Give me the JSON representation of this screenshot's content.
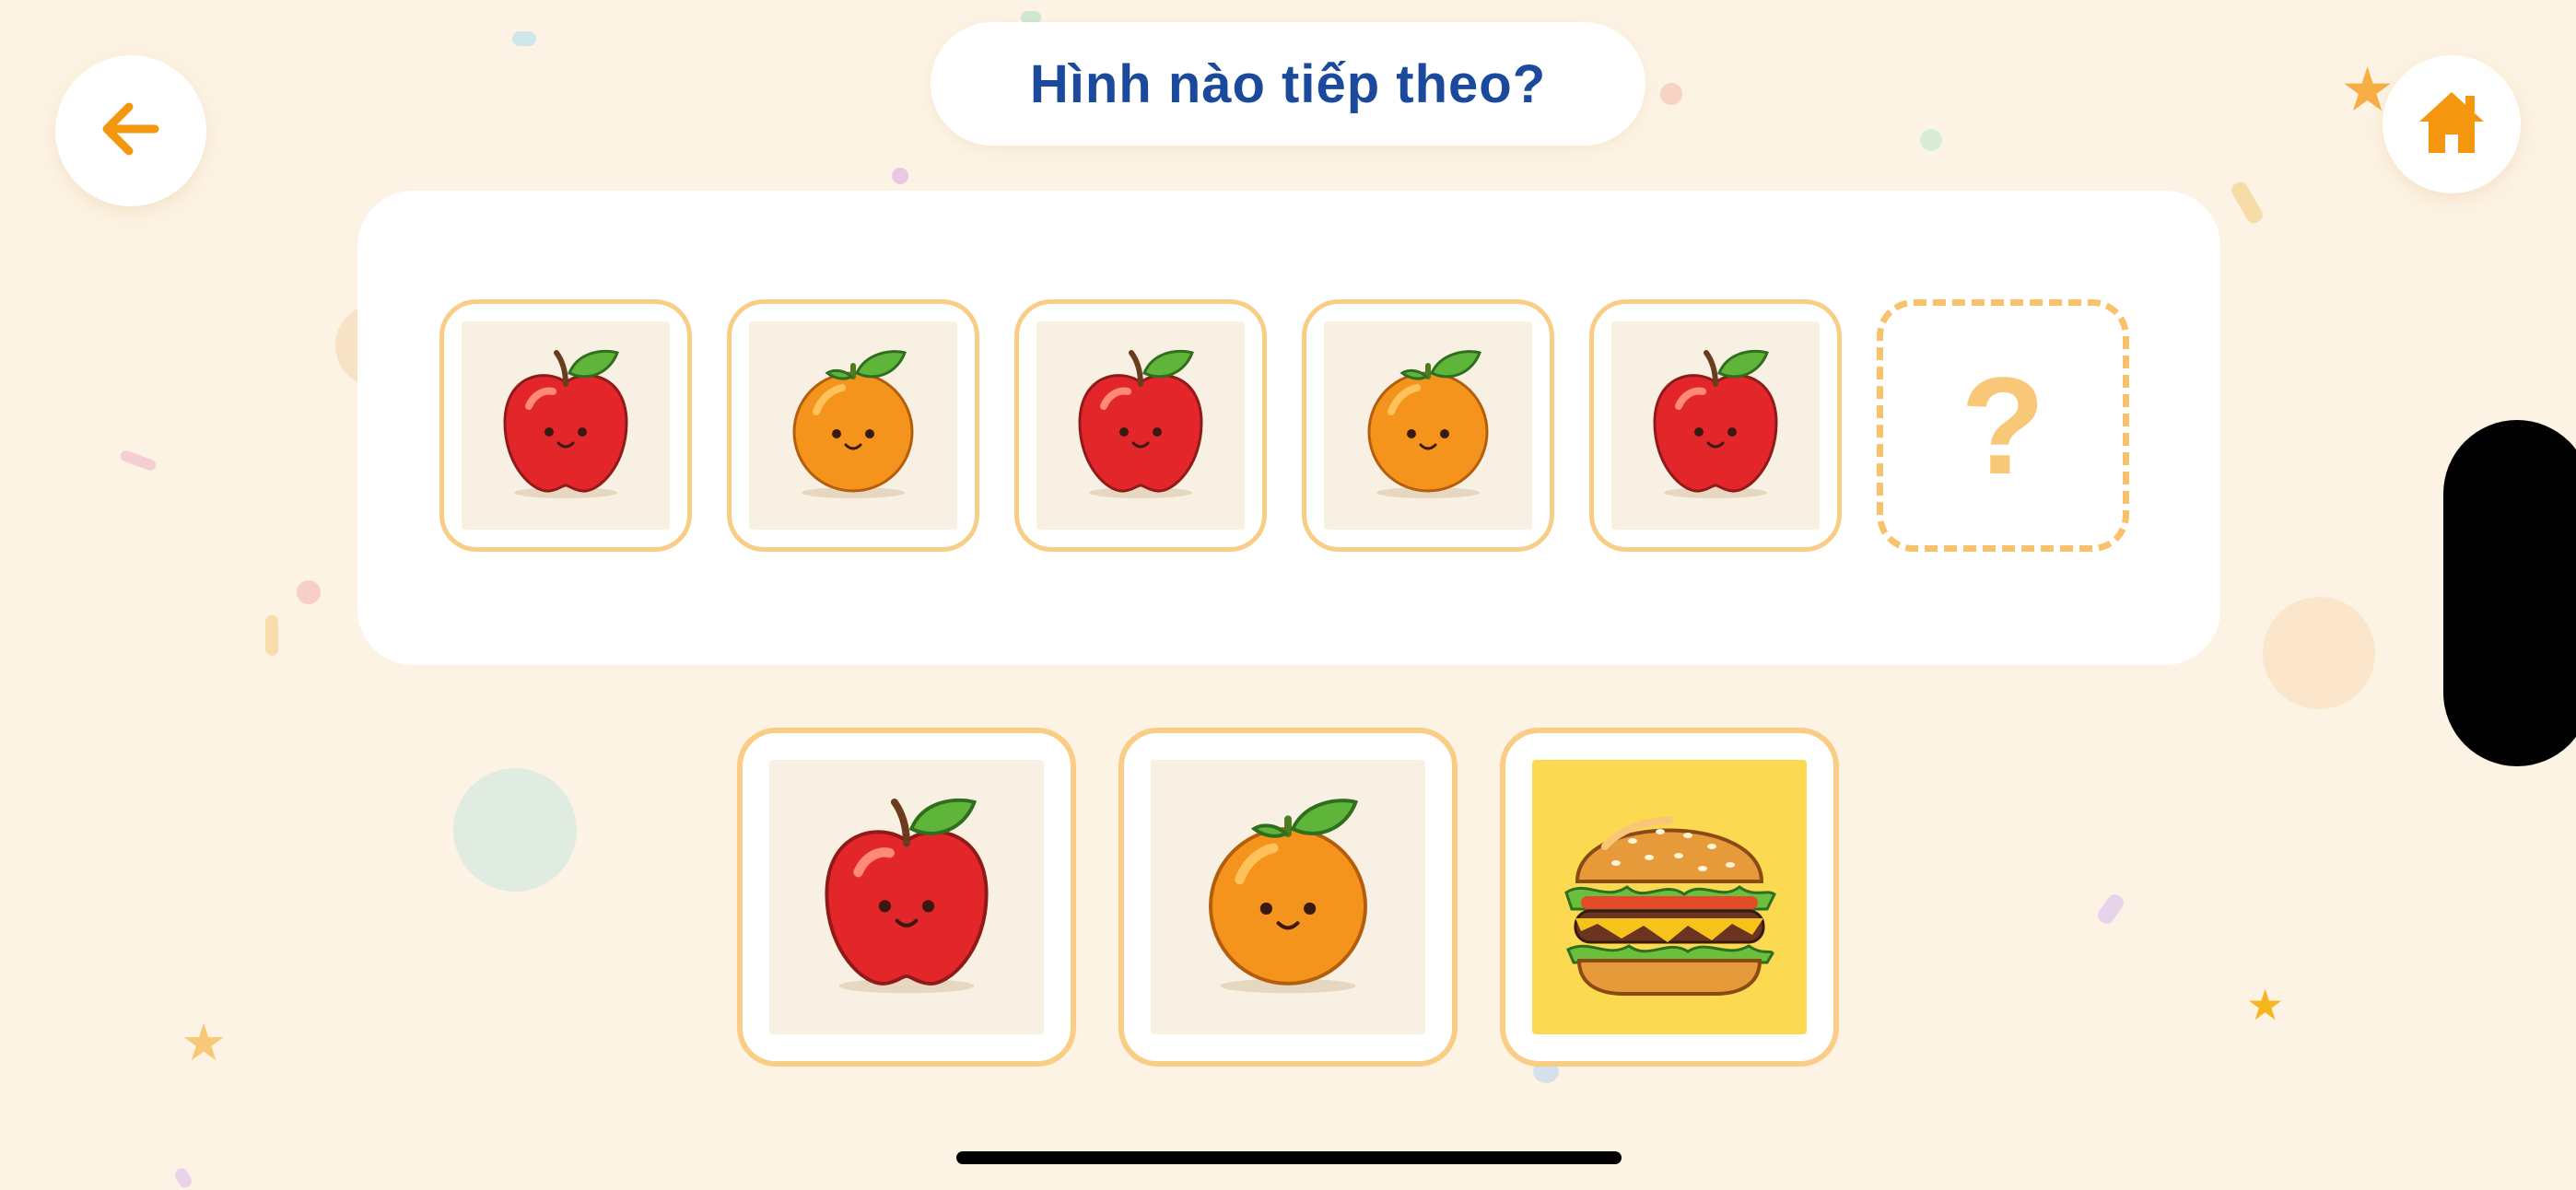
{
  "header": {
    "title": "Hình nào tiếp theo?",
    "back_icon": "arrow-left-icon",
    "home_icon": "home-icon"
  },
  "sequence": {
    "items": [
      "apple",
      "orange",
      "apple",
      "orange",
      "apple"
    ],
    "placeholder": "?"
  },
  "choices": [
    "apple",
    "orange",
    "hamburger"
  ],
  "colors": {
    "background": "#fdf3e4",
    "accent": "#f5960f",
    "title": "#1b4a9c",
    "tile_border": "#f9cd86"
  }
}
